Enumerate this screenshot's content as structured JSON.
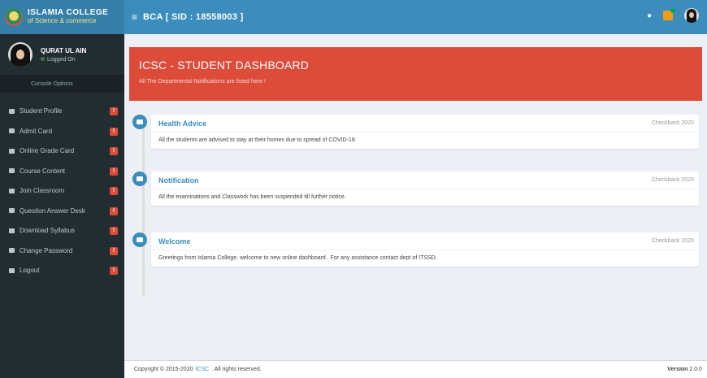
{
  "logo": {
    "line1": "ISLAMIA COLLEGE",
    "line2": "of Science & commerce"
  },
  "user": {
    "name": "QURAT UL AIN",
    "status": "Logged On",
    "console": "Console Options"
  },
  "menu": [
    {
      "label": "Student Profile",
      "badge": "!"
    },
    {
      "label": "Admit Card",
      "badge": "!"
    },
    {
      "label": "Online Grade Card",
      "badge": "!"
    },
    {
      "label": "Course Content",
      "badge": "!"
    },
    {
      "label": "Join Classroom",
      "badge": "!"
    },
    {
      "label": "Question Answer Desk",
      "badge": "!"
    },
    {
      "label": "Download Syllabus",
      "badge": "!"
    },
    {
      "label": "Change Password",
      "badge": "!"
    },
    {
      "label": "Logout",
      "badge": "!"
    }
  ],
  "topbar": {
    "menu_icon": "≡",
    "title": "BCA [ SID : 18558003 ]",
    "bell_icon": "bell-icon",
    "flag_icon": "flag-icon"
  },
  "header": {
    "title": "ICSC - STUDENT DASHBOARD",
    "subtitle": "All The Departmental Notifications are listed here !"
  },
  "timeline": [
    {
      "title": "Health Advice",
      "time": "Checkback 2020",
      "body": "All the students are advised to stay at their homes due to spread of COVID-19."
    },
    {
      "title": "Notification",
      "time": "Checkback 2020",
      "body": "All the examinations and Classwork has been suspended till further notice."
    },
    {
      "title": "Welcome",
      "time": "Checkback 2020",
      "body": "Greetings from Islamia College, welcome to new online dashboard . For any assistance contact dept of ITSSD."
    }
  ],
  "footer": {
    "copyright_pre": "Copyright © 2015-2020",
    "link": "ICSC",
    "copyright_post": ". All rights reserved.",
    "version_label": "Version",
    "version": "2.0.0"
  },
  "colors": {
    "sidebar": "#222d32",
    "topbar": "#3c8dbc",
    "logo_bg": "#367fa9",
    "header": "#dd4b39",
    "accent": "#3c8dbc",
    "badge": "#dd4b39"
  }
}
